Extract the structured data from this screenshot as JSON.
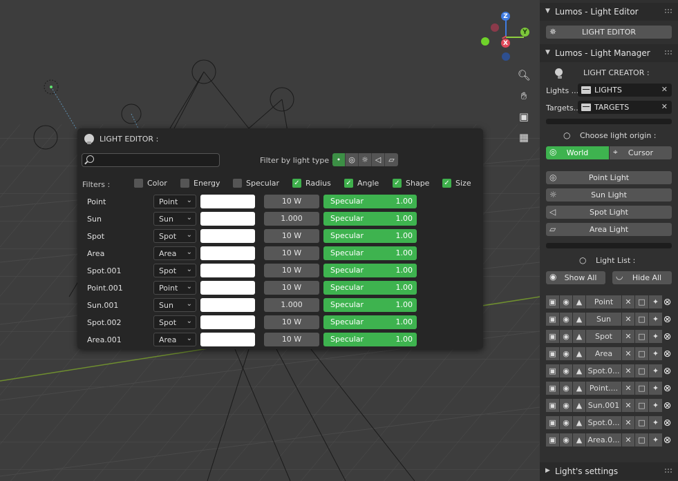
{
  "editor": {
    "title": "LIGHT EDITOR :",
    "search_placeholder": "",
    "filter_by_type_label": "Filter by light type :",
    "filters_label": "Filters :",
    "filters": [
      {
        "label": "Color",
        "checked": false
      },
      {
        "label": "Energy",
        "checked": false
      },
      {
        "label": "Specular",
        "checked": false
      },
      {
        "label": "Radius",
        "checked": true
      },
      {
        "label": "Angle",
        "checked": true
      },
      {
        "label": "Shape",
        "checked": true
      },
      {
        "label": "Size",
        "checked": true
      }
    ],
    "lights": [
      {
        "name": "Point",
        "type": "Point",
        "energy": "10 W",
        "spec_label": "Specular",
        "spec_value": "1.00"
      },
      {
        "name": "Sun",
        "type": "Sun",
        "energy": "1.000",
        "spec_label": "Specular",
        "spec_value": "1.00"
      },
      {
        "name": "Spot",
        "type": "Spot",
        "energy": "10 W",
        "spec_label": "Specular",
        "spec_value": "1.00"
      },
      {
        "name": "Area",
        "type": "Area",
        "energy": "10 W",
        "spec_label": "Specular",
        "spec_value": "1.00"
      },
      {
        "name": "Spot.001",
        "type": "Spot",
        "energy": "10 W",
        "spec_label": "Specular",
        "spec_value": "1.00"
      },
      {
        "name": "Point.001",
        "type": "Point",
        "energy": "10 W",
        "spec_label": "Specular",
        "spec_value": "1.00"
      },
      {
        "name": "Sun.001",
        "type": "Sun",
        "energy": "1.000",
        "spec_label": "Specular",
        "spec_value": "1.00"
      },
      {
        "name": "Spot.002",
        "type": "Spot",
        "energy": "10 W",
        "spec_label": "Specular",
        "spec_value": "1.00"
      },
      {
        "name": "Area.001",
        "type": "Area",
        "energy": "10 W",
        "spec_label": "Specular",
        "spec_value": "1.00"
      }
    ]
  },
  "gizmo": {
    "z": "Z",
    "y": "Y",
    "x": "X"
  },
  "sidebar": {
    "panel1_title": "Lumos - Light Editor",
    "light_editor_button": "LIGHT EDITOR",
    "panel2_title": "Lumos - Light Manager",
    "creator_label": "LIGHT CREATOR :",
    "lights_label": "Lights ...",
    "lights_value": "LIGHTS",
    "targets_label": "Targets...",
    "targets_value": "TARGETS",
    "origin_label": "Choose light origin :",
    "origin_world": "World",
    "origin_cursor": "Cursor",
    "add_point": "Point Light",
    "add_sun": "Sun Light",
    "add_spot": "Spot Light",
    "add_area": "Area Light",
    "list_label": "Light List :",
    "show_all": "Show All",
    "hide_all": "Hide All",
    "list": [
      "Point",
      "Sun",
      "Spot",
      "Area",
      "Spot.0...",
      "Point....",
      "Sun.001",
      "Spot.0...",
      "Area.0..."
    ],
    "settings_title": "Light's settings"
  }
}
